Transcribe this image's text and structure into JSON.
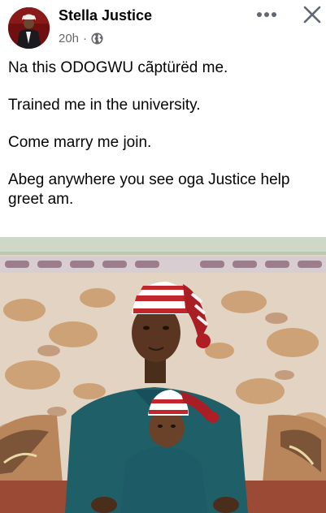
{
  "post": {
    "author_name": "Stella Justice",
    "timestamp": "20h",
    "separator": "·",
    "privacy_icon": "globe-icon",
    "more_icon": "more-options-icon",
    "close_icon": "close-icon",
    "paragraphs": [
      "Na this ODOGWU cãptürëd me.",
      "Trained me in the university.",
      "Come marry me join.",
      "Abeg anywhere you see oga Justice help greet am."
    ]
  },
  "colors": {
    "text_primary": "#050505",
    "text_secondary": "#65676b",
    "icon_gray": "#606770"
  }
}
